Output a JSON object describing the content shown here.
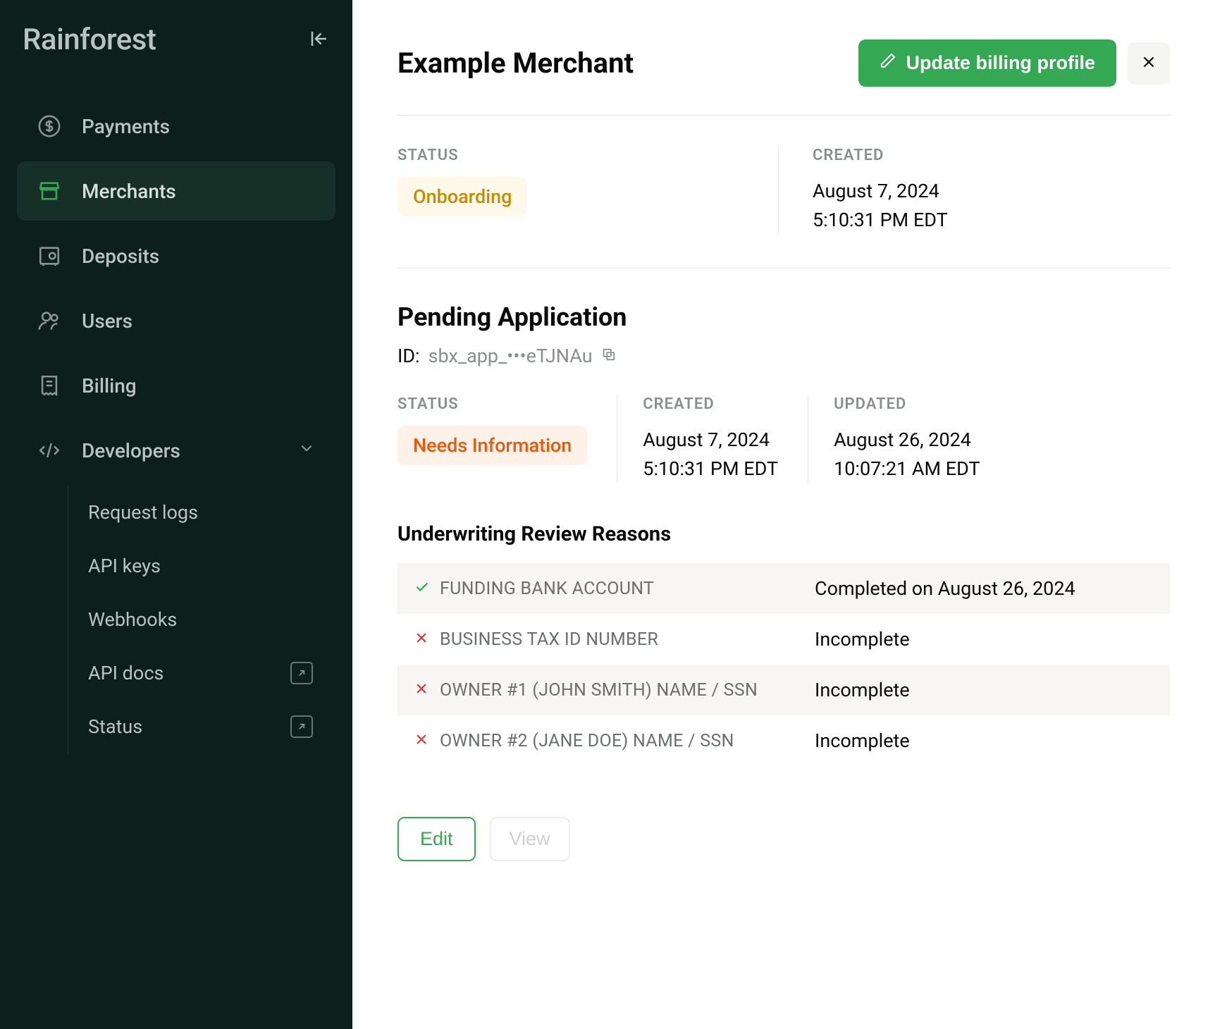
{
  "brand": "Rainforest",
  "sidebar": {
    "items": [
      {
        "label": "Payments"
      },
      {
        "label": "Merchants"
      },
      {
        "label": "Deposits"
      },
      {
        "label": "Users"
      },
      {
        "label": "Billing"
      },
      {
        "label": "Developers"
      }
    ],
    "subitems": [
      {
        "label": "Request logs"
      },
      {
        "label": "API keys"
      },
      {
        "label": "Webhooks"
      },
      {
        "label": "API docs"
      },
      {
        "label": "Status"
      }
    ]
  },
  "header": {
    "title": "Example Merchant",
    "update_button": "Update billing profile"
  },
  "merchant": {
    "status_label": "STATUS",
    "status_value": "Onboarding",
    "created_label": "CREATED",
    "created_date": "August 7, 2024",
    "created_time": "5:10:31 PM EDT"
  },
  "application": {
    "title": "Pending Application",
    "id_label": "ID:",
    "id_value": "sbx_app_•••eTJNAu",
    "status_label": "STATUS",
    "status_value": "Needs Information",
    "created_label": "CREATED",
    "created_date": "August 7, 2024",
    "created_time": "5:10:31 PM EDT",
    "updated_label": "UPDATED",
    "updated_date": "August 26, 2024",
    "updated_time": "10:07:21 AM EDT"
  },
  "review": {
    "title": "Underwriting Review Reasons",
    "rows": [
      {
        "reason": "FUNDING BANK ACCOUNT",
        "status": "Completed on August 26, 2024",
        "complete": true
      },
      {
        "reason": "BUSINESS TAX ID NUMBER",
        "status": "Incomplete",
        "complete": false
      },
      {
        "reason": "OWNER #1 (JOHN SMITH) NAME / SSN",
        "status": "Incomplete",
        "complete": false
      },
      {
        "reason": "OWNER #2 (JANE DOE) NAME / SSN",
        "status": "Incomplete",
        "complete": false
      }
    ]
  },
  "actions": {
    "edit": "Edit",
    "view": "View"
  }
}
